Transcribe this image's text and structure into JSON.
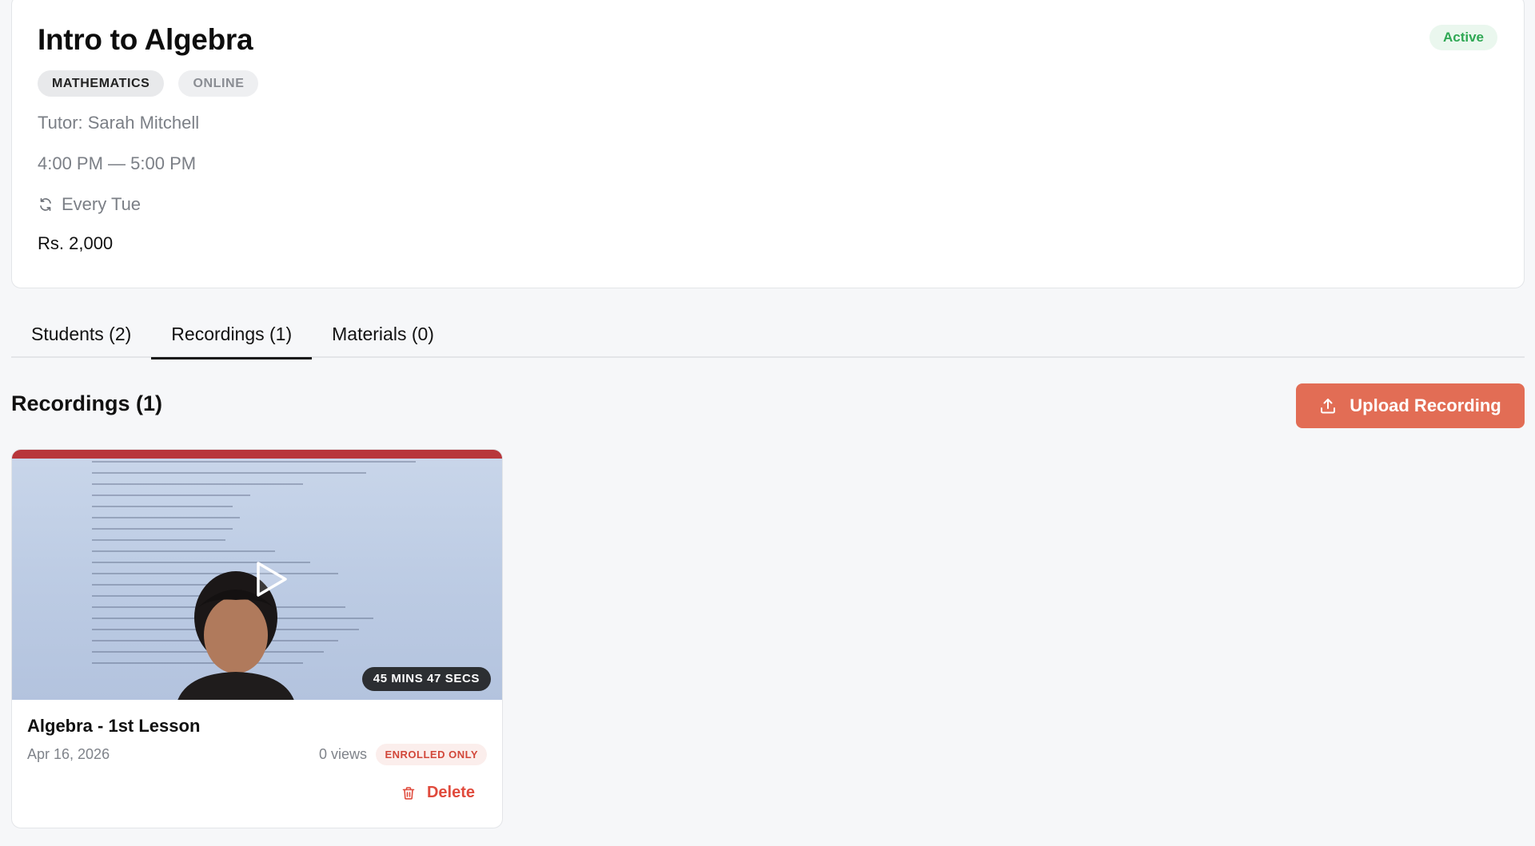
{
  "class": {
    "title": "Intro to Algebra",
    "status": "Active",
    "tags": [
      "MATHEMATICS",
      "ONLINE"
    ],
    "tutor": "Tutor: Sarah Mitchell",
    "time": "4:00 PM — 5:00 PM",
    "repeat": "Every Tue",
    "price": "Rs. 2,000"
  },
  "tabs": [
    {
      "label": "Students (2)",
      "active": false
    },
    {
      "label": "Recordings (1)",
      "active": true
    },
    {
      "label": "Materials (0)",
      "active": false
    }
  ],
  "section": {
    "title": "Recordings (1)",
    "upload_label": "Upload Recording"
  },
  "recording": {
    "title": "Algebra - 1st Lesson",
    "date": "Apr 16, 2026",
    "views": "0 views",
    "access": "ENROLLED ONLY",
    "duration": "45 MINS 47 SECS",
    "delete_label": "Delete"
  },
  "colors": {
    "accent": "#e26d55",
    "active_status": "#2fa854",
    "danger": "#e04a3c"
  },
  "icons": {
    "repeat": "refresh-icon",
    "upload": "upload-icon",
    "play": "play-icon",
    "delete": "trash-icon"
  }
}
